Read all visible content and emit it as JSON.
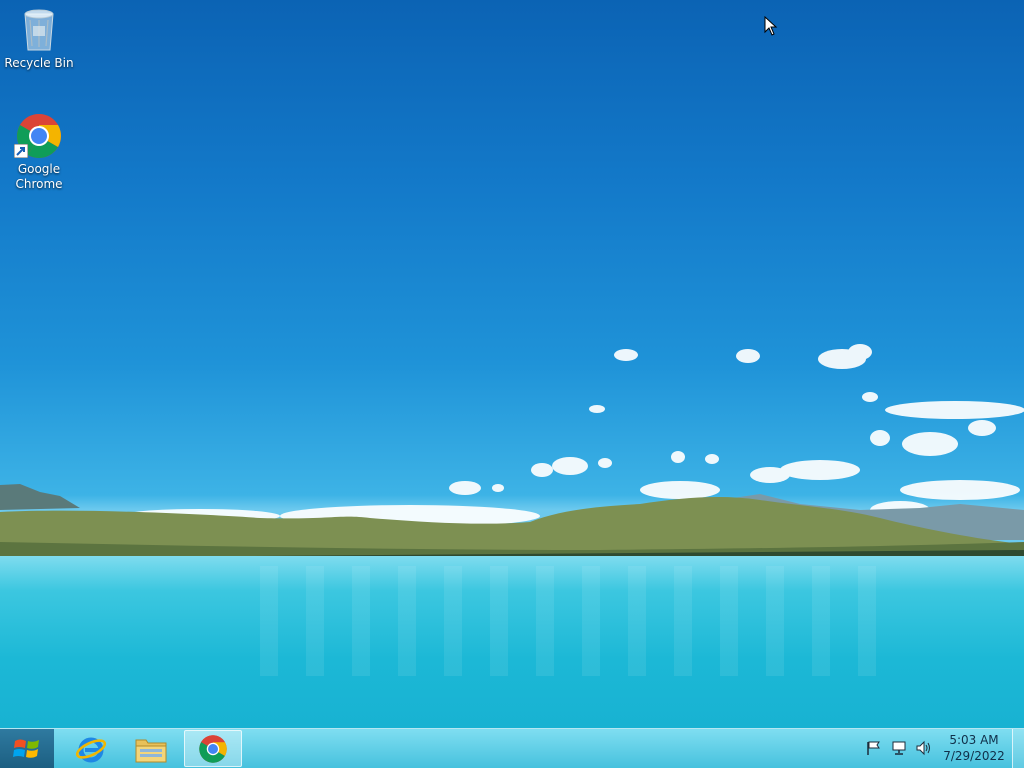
{
  "desktop": {
    "icons": [
      {
        "label": "Recycle Bin",
        "icon": "recycle-bin-icon"
      },
      {
        "label": "Google Chrome",
        "icon": "chrome-icon"
      }
    ]
  },
  "taskbar": {
    "start": {
      "icon": "windows-logo-icon"
    },
    "pinned": [
      {
        "name": "Internet Explorer",
        "icon": "internet-explorer-icon"
      },
      {
        "name": "File Explorer",
        "icon": "file-explorer-icon"
      },
      {
        "name": "Google Chrome",
        "icon": "chrome-icon",
        "active": true
      }
    ],
    "tray": {
      "icons": [
        "action-center-flag-icon",
        "network-icon",
        "volume-icon"
      ],
      "time": "5:03 AM",
      "date": "7/29/2022"
    }
  },
  "colors": {
    "sky_top": "#0b63b4",
    "water": "#1cb8d6",
    "taskbar": "#5cc8e2"
  }
}
